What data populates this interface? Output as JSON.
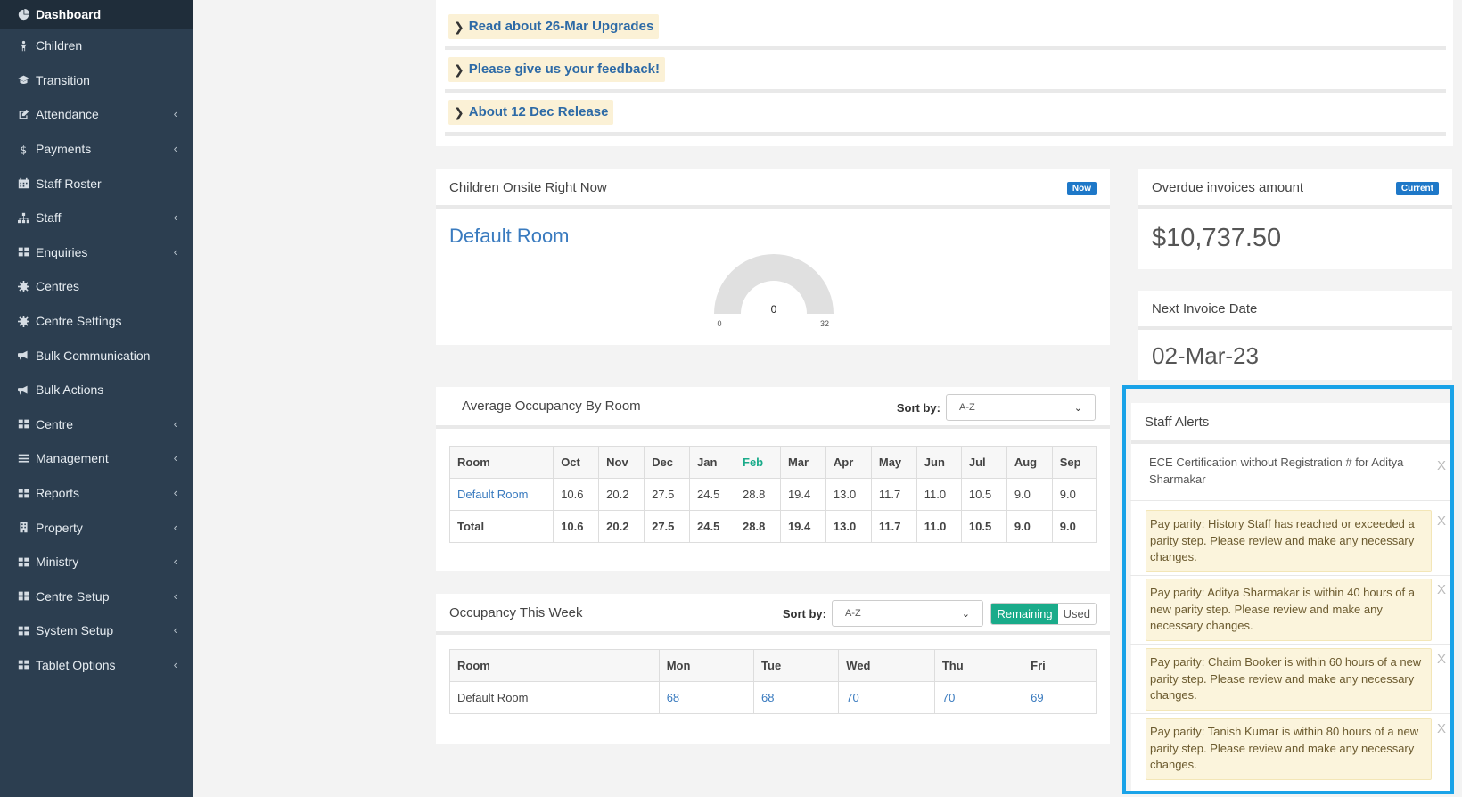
{
  "sidebar": {
    "items": [
      {
        "label": "Dashboard",
        "icon": "dashboard-icon",
        "active": true,
        "chevron": false
      },
      {
        "label": "Children",
        "icon": "child-icon",
        "chevron": false
      },
      {
        "label": "Transition",
        "icon": "graduation-cap-icon",
        "chevron": false
      },
      {
        "label": "Attendance",
        "icon": "edit-icon",
        "chevron": true
      },
      {
        "label": "Payments",
        "icon": "dollar-icon",
        "chevron": true
      },
      {
        "label": "Staff Roster",
        "icon": "calendar-icon",
        "chevron": false
      },
      {
        "label": "Staff",
        "icon": "sitemap-icon",
        "chevron": true
      },
      {
        "label": "Enquiries",
        "icon": "grid-icon",
        "chevron": true
      },
      {
        "label": "Centres",
        "icon": "gear-icon",
        "chevron": false
      },
      {
        "label": "Centre Settings",
        "icon": "gear-icon",
        "chevron": false
      },
      {
        "label": "Bulk Communication",
        "icon": "bullhorn-icon",
        "chevron": false
      },
      {
        "label": "Bulk Actions",
        "icon": "bullhorn-icon",
        "chevron": false
      },
      {
        "label": "Centre",
        "icon": "grid-icon",
        "chevron": true
      },
      {
        "label": "Management",
        "icon": "list-icon",
        "chevron": true
      },
      {
        "label": "Reports",
        "icon": "grid-icon",
        "chevron": true
      },
      {
        "label": "Property",
        "icon": "building-icon",
        "chevron": true
      },
      {
        "label": "Ministry",
        "icon": "grid-icon",
        "chevron": true
      },
      {
        "label": "Centre Setup",
        "icon": "grid-icon",
        "chevron": true
      },
      {
        "label": "System Setup",
        "icon": "grid-icon",
        "chevron": true
      },
      {
        "label": "Tablet Options",
        "icon": "grid-icon",
        "chevron": true
      }
    ],
    "chevron_glyph": "‹"
  },
  "announcements": {
    "links": [
      "Read about 26-Mar Upgrades",
      "Please give us your feedback!",
      "About 12 Dec Release"
    ]
  },
  "onsite": {
    "title": "Children Onsite Right Now",
    "badge": "Now",
    "room": "Default Room",
    "gauge": {
      "value": 0,
      "min": "0",
      "max": "32",
      "value_label": "0"
    }
  },
  "overdue": {
    "title": "Overdue invoices amount",
    "badge": "Current",
    "amount": "$10,737.50"
  },
  "next_invoice": {
    "title": "Next Invoice Date",
    "date": "02-Mar-23"
  },
  "avg_occupancy": {
    "title": "Average Occupancy By Room",
    "sort_label": "Sort by:",
    "sort_value": "A-Z",
    "columns": [
      "Room",
      "Oct",
      "Nov",
      "Dec",
      "Jan",
      "Feb",
      "Mar",
      "Apr",
      "May",
      "Jun",
      "Jul",
      "Aug",
      "Sep"
    ],
    "rows": [
      [
        "Default Room",
        "10.6",
        "20.2",
        "27.5",
        "24.5",
        "28.8",
        "19.4",
        "13.0",
        "11.7",
        "11.0",
        "10.5",
        "9.0",
        "9.0"
      ],
      [
        "Total",
        "10.6",
        "20.2",
        "27.5",
        "24.5",
        "28.8",
        "19.4",
        "13.0",
        "11.7",
        "11.0",
        "10.5",
        "9.0",
        "9.0"
      ]
    ]
  },
  "week_occupancy": {
    "title": "Occupancy This Week",
    "sort_label": "Sort by:",
    "sort_value": "A-Z",
    "toggle_on": "Remaining",
    "toggle_off": "Used",
    "columns": [
      "Room",
      "Mon",
      "Tue",
      "Wed",
      "Thu",
      "Fri"
    ],
    "rows": [
      [
        "Default Room",
        "68",
        "68",
        "70",
        "70",
        "69"
      ]
    ]
  },
  "staff_alerts": {
    "title": "Staff Alerts",
    "close_glyph": "X",
    "items": [
      "ECE Certification without Registration # for Aditya Sharmakar",
      "Pay parity: History Staff has reached or exceeded a parity step. Please review and make any necessary changes.",
      "Pay parity: Aditya Sharmakar is within 40 hours of a new parity step. Please review and make any necessary changes.",
      "Pay parity: Chaim Booker is within 60 hours of a new parity step. Please review and make any necessary changes.",
      "Pay parity: Tanish Kumar is within 80 hours of a new parity step. Please review and make any necessary changes."
    ]
  },
  "colors": {
    "sidebar_bg": "#2c3e50",
    "accent_blue": "#1e78c8",
    "accent_green": "#1aab8a",
    "alert_border": "#1aa3e8"
  }
}
